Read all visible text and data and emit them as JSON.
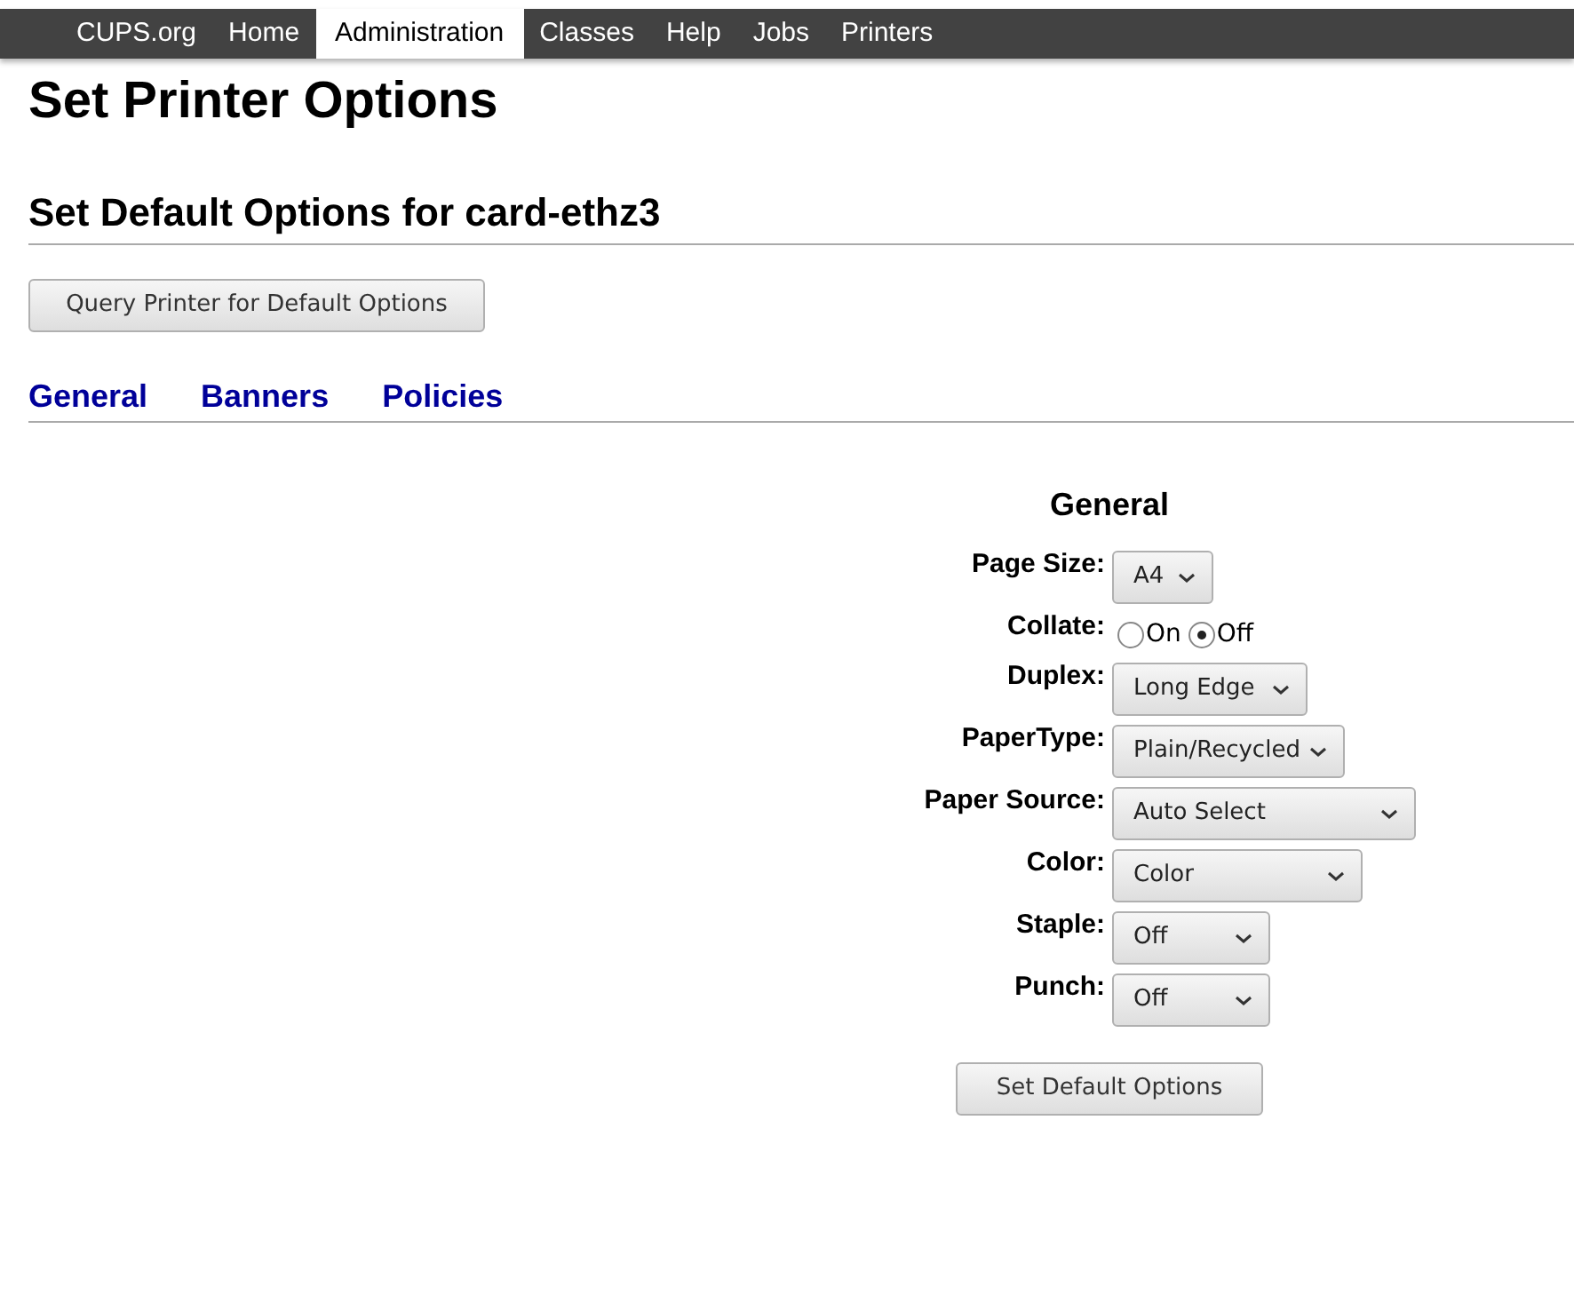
{
  "nav": [
    {
      "label": "CUPS.org",
      "selected": false
    },
    {
      "label": "Home",
      "selected": false
    },
    {
      "label": "Administration",
      "selected": true
    },
    {
      "label": "Classes",
      "selected": false
    },
    {
      "label": "Help",
      "selected": false
    },
    {
      "label": "Jobs",
      "selected": false
    },
    {
      "label": "Printers",
      "selected": false
    }
  ],
  "title": "Set Printer Options",
  "subtitle": "Set Default Options for card-ethz3",
  "query_button": "Query Printer for Default Options",
  "tabs": [
    {
      "label": "General"
    },
    {
      "label": "Banners"
    },
    {
      "label": "Policies"
    }
  ],
  "section": {
    "heading": "General",
    "options": [
      {
        "kind": "select",
        "label": "Page Size:",
        "value": "A4"
      },
      {
        "kind": "radio",
        "label": "Collate:",
        "choices": [
          {
            "label": "On",
            "selected": false
          },
          {
            "label": "Off",
            "selected": true
          }
        ]
      },
      {
        "kind": "select",
        "label": "Duplex:",
        "value": "Long Edge"
      },
      {
        "kind": "select",
        "label": "PaperType:",
        "value": "Plain/Recycled"
      },
      {
        "kind": "select",
        "label": "Paper Source:",
        "value": "Auto Select"
      },
      {
        "kind": "select",
        "label": "Color:",
        "value": "Color"
      },
      {
        "kind": "select",
        "label": "Staple:",
        "value": "Off"
      },
      {
        "kind": "select",
        "label": "Punch:",
        "value": "Off"
      }
    ]
  },
  "submit_button": "Set Default Options"
}
